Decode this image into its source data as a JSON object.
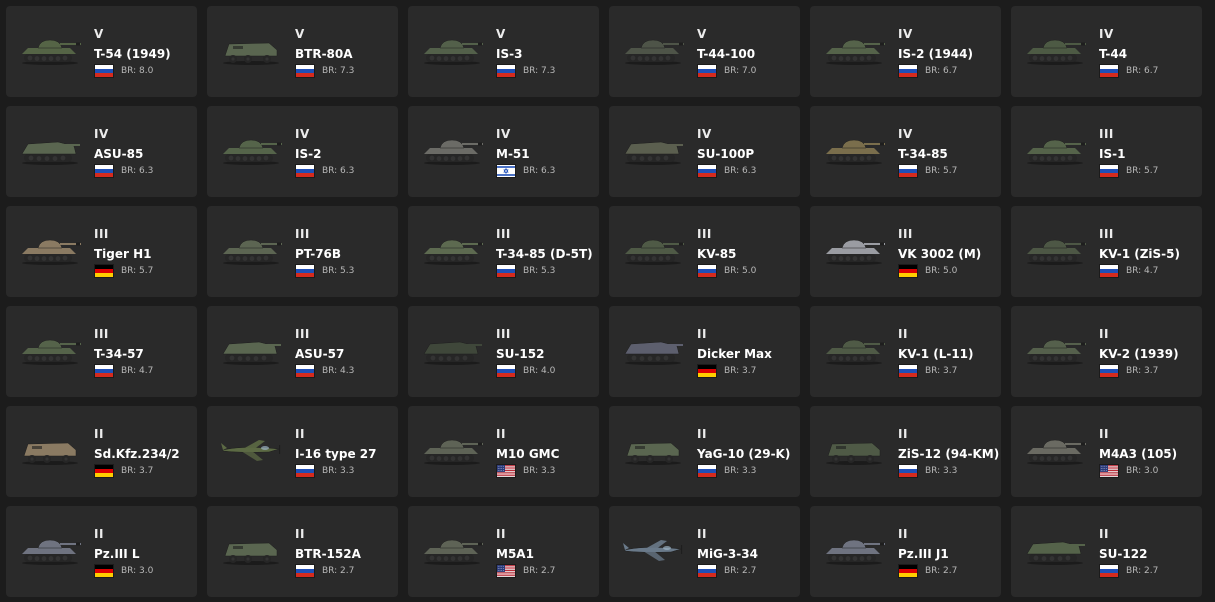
{
  "colors": {
    "background": "#1c1c1c",
    "card": "#2a2a2a",
    "text": "#ffffff",
    "muted": "#b8b8b8"
  },
  "vehicles": [
    {
      "rank": "V",
      "name": "T-54 (1949)",
      "nation": "ussr",
      "br": "BR: 8.0",
      "kind": "tank",
      "color": "#556446"
    },
    {
      "rank": "V",
      "name": "BTR-80A",
      "nation": "ussr",
      "br": "BR: 7.3",
      "kind": "apc",
      "color": "#5a6650"
    },
    {
      "rank": "V",
      "name": "IS-3",
      "nation": "ussr",
      "br": "BR: 7.3",
      "kind": "tank",
      "color": "#53604a"
    },
    {
      "rank": "V",
      "name": "T-44-100",
      "nation": "ussr",
      "br": "BR: 7.0",
      "kind": "tank",
      "color": "#4e5448"
    },
    {
      "rank": "IV",
      "name": "IS-2 (1944)",
      "nation": "ussr",
      "br": "BR: 6.7",
      "kind": "tank",
      "color": "#55634a"
    },
    {
      "rank": "IV",
      "name": "T-44",
      "nation": "ussr",
      "br": "BR: 6.7",
      "kind": "tank",
      "color": "#4d5a44"
    },
    {
      "rank": "IV",
      "name": "ASU-85",
      "nation": "ussr",
      "br": "BR: 6.3",
      "kind": "spg",
      "color": "#5a6650"
    },
    {
      "rank": "IV",
      "name": "IS-2",
      "nation": "ussr",
      "br": "BR: 6.3",
      "kind": "tank",
      "color": "#55644a"
    },
    {
      "rank": "IV",
      "name": "M-51",
      "nation": "israel",
      "br": "BR: 6.3",
      "kind": "tank",
      "color": "#6b6b66"
    },
    {
      "rank": "IV",
      "name": "SU-100P",
      "nation": "ussr",
      "br": "BR: 6.3",
      "kind": "spg",
      "color": "#5b5f4f"
    },
    {
      "rank": "IV",
      "name": "T-34-85",
      "nation": "ussr",
      "br": "BR: 5.7",
      "kind": "tank",
      "color": "#7a6e4c"
    },
    {
      "rank": "III",
      "name": "IS-1",
      "nation": "ussr",
      "br": "BR: 5.7",
      "kind": "tank",
      "color": "#55634a"
    },
    {
      "rank": "III",
      "name": "Tiger H1",
      "nation": "germany",
      "br": "BR: 5.7",
      "kind": "tank",
      "color": "#8a7a62"
    },
    {
      "rank": "III",
      "name": "PT-76B",
      "nation": "ussr",
      "br": "BR: 5.3",
      "kind": "tank",
      "color": "#5c6552"
    },
    {
      "rank": "III",
      "name": "T-34-85 (D-5T)",
      "nation": "ussr",
      "br": "BR: 5.3",
      "kind": "tank",
      "color": "#5d6a50"
    },
    {
      "rank": "III",
      "name": "KV-85",
      "nation": "ussr",
      "br": "BR: 5.0",
      "kind": "tank",
      "color": "#4f5a46"
    },
    {
      "rank": "III",
      "name": "VK 3002 (M)",
      "nation": "germany",
      "br": "BR: 5.0",
      "kind": "tank",
      "color": "#9a9ca2"
    },
    {
      "rank": "III",
      "name": "KV-1 (ZiS-5)",
      "nation": "ussr",
      "br": "BR: 4.7",
      "kind": "tank",
      "color": "#4d5745"
    },
    {
      "rank": "III",
      "name": "T-34-57",
      "nation": "ussr",
      "br": "BR: 4.7",
      "kind": "tank",
      "color": "#55634a"
    },
    {
      "rank": "III",
      "name": "ASU-57",
      "nation": "ussr",
      "br": "BR: 4.3",
      "kind": "spg",
      "color": "#5a6650"
    },
    {
      "rank": "III",
      "name": "SU-152",
      "nation": "ussr",
      "br": "BR: 4.0",
      "kind": "spg",
      "color": "#3f473a"
    },
    {
      "rank": "II",
      "name": "Dicker Max",
      "nation": "germany",
      "br": "BR: 3.7",
      "kind": "spg",
      "color": "#5d5f6e"
    },
    {
      "rank": "II",
      "name": "KV-1 (L-11)",
      "nation": "ussr",
      "br": "BR: 3.7",
      "kind": "tank",
      "color": "#4f5a46"
    },
    {
      "rank": "II",
      "name": "KV-2 (1939)",
      "nation": "ussr",
      "br": "BR: 3.7",
      "kind": "tank",
      "color": "#55604c"
    },
    {
      "rank": "II",
      "name": "Sd.Kfz.234/2",
      "nation": "germany",
      "br": "BR: 3.7",
      "kind": "car",
      "color": "#8a7a62"
    },
    {
      "rank": "II",
      "name": "I-16 type 27",
      "nation": "ussr",
      "br": "BR: 3.3",
      "kind": "plane",
      "color": "#5c6a44"
    },
    {
      "rank": "II",
      "name": "M10 GMC",
      "nation": "usa",
      "br": "BR: 3.3",
      "kind": "tank",
      "color": "#5e6356"
    },
    {
      "rank": "II",
      "name": "YaG-10 (29-K)",
      "nation": "ussr",
      "br": "BR: 3.3",
      "kind": "truck",
      "color": "#5a6650"
    },
    {
      "rank": "II",
      "name": "ZiS-12 (94-KM)",
      "nation": "ussr",
      "br": "BR: 3.3",
      "kind": "truck",
      "color": "#4f5a46"
    },
    {
      "rank": "II",
      "name": "M4A3 (105)",
      "nation": "usa",
      "br": "BR: 3.0",
      "kind": "tank",
      "color": "#6a6a62"
    },
    {
      "rank": "II",
      "name": "Pz.III L",
      "nation": "germany",
      "br": "BR: 3.0",
      "kind": "tank",
      "color": "#6f7380"
    },
    {
      "rank": "II",
      "name": "BTR-152A",
      "nation": "ussr",
      "br": "BR: 2.7",
      "kind": "truck",
      "color": "#5a6650"
    },
    {
      "rank": "II",
      "name": "M5A1",
      "nation": "usa",
      "br": "BR: 2.7",
      "kind": "tank",
      "color": "#5e6356"
    },
    {
      "rank": "II",
      "name": "MiG-3-34",
      "nation": "ussr",
      "br": "BR: 2.7",
      "kind": "plane",
      "color": "#6a7a8a"
    },
    {
      "rank": "II",
      "name": "Pz.III J1",
      "nation": "germany",
      "br": "BR: 2.7",
      "kind": "tank",
      "color": "#6f7380"
    },
    {
      "rank": "II",
      "name": "SU-122",
      "nation": "ussr",
      "br": "BR: 2.7",
      "kind": "spg",
      "color": "#55634a"
    }
  ]
}
